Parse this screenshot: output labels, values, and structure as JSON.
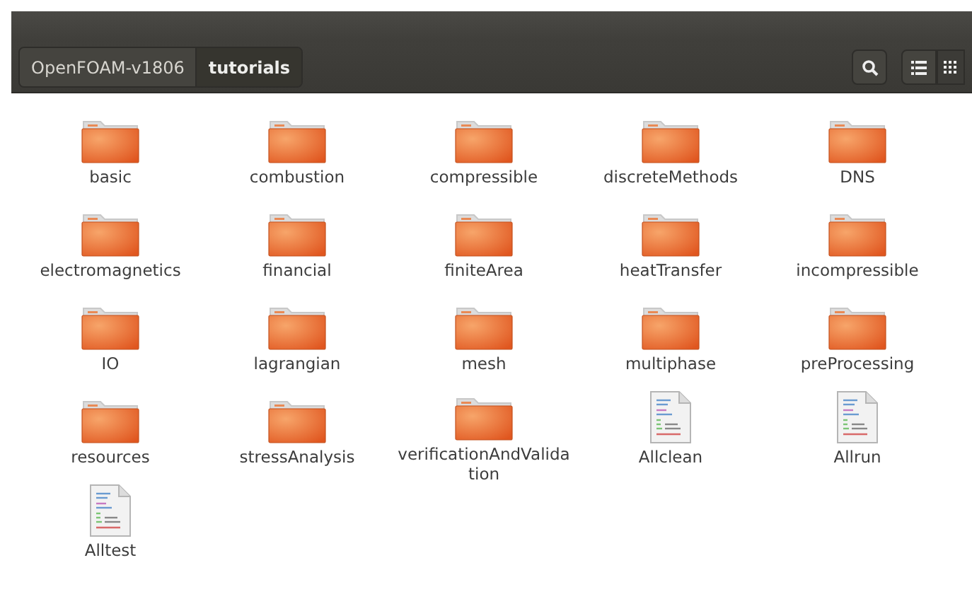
{
  "breadcrumb": [
    {
      "label": "OpenFOAM-v1806",
      "selected": false
    },
    {
      "label": "tutorials",
      "selected": true
    }
  ],
  "items": [
    {
      "name": "basic",
      "kind": "folder"
    },
    {
      "name": "combustion",
      "kind": "folder"
    },
    {
      "name": "compressible",
      "kind": "folder"
    },
    {
      "name": "discreteMethods",
      "kind": "folder"
    },
    {
      "name": "DNS",
      "kind": "folder"
    },
    {
      "name": "electromagnetics",
      "kind": "folder"
    },
    {
      "name": "financial",
      "kind": "folder"
    },
    {
      "name": "finiteArea",
      "kind": "folder"
    },
    {
      "name": "heatTransfer",
      "kind": "folder"
    },
    {
      "name": "incompressible",
      "kind": "folder"
    },
    {
      "name": "IO",
      "kind": "folder"
    },
    {
      "name": "lagrangian",
      "kind": "folder"
    },
    {
      "name": "mesh",
      "kind": "folder"
    },
    {
      "name": "multiphase",
      "kind": "folder"
    },
    {
      "name": "preProcessing",
      "kind": "folder"
    },
    {
      "name": "resources",
      "kind": "folder"
    },
    {
      "name": "stressAnalysis",
      "kind": "folder"
    },
    {
      "name": "verificationAndValidation",
      "kind": "folder"
    },
    {
      "name": "Allclean",
      "kind": "script"
    },
    {
      "name": "Allrun",
      "kind": "script"
    },
    {
      "name": "Alltest",
      "kind": "script"
    }
  ]
}
